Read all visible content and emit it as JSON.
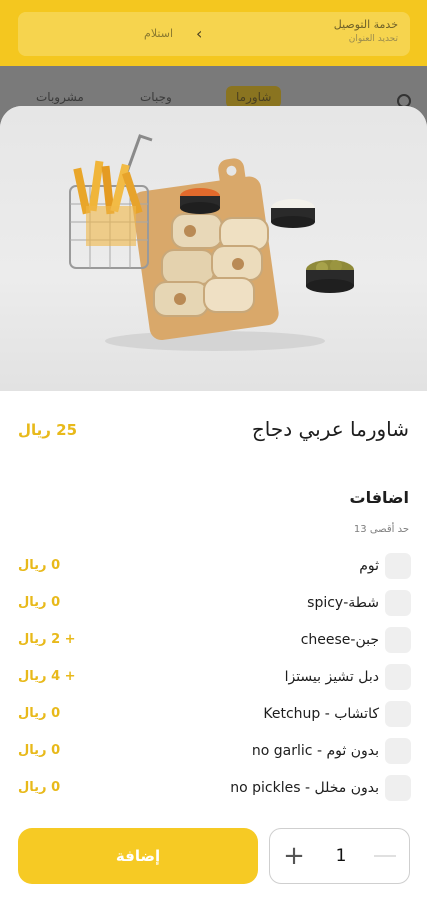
{
  "background": {
    "delivery_title": "خدمة التوصيل",
    "delivery_subtitle": "تحديد العنوان",
    "pickup_label": "استلام",
    "tabs": [
      "مشروبات",
      "وجبات",
      "شاورما"
    ]
  },
  "product": {
    "title": "شاورما عربي دجاج",
    "price": "25 ريال"
  },
  "addons": {
    "title": "اضافات",
    "limit_text": "حد أقصى 13",
    "items": [
      {
        "name": "ثوم",
        "price": "0 ريال",
        "checked": false
      },
      {
        "name": "شطة-spicy",
        "price": "0 ريال",
        "checked": false
      },
      {
        "name": "جبن-cheese",
        "price": "+ 2 ريال",
        "checked": false
      },
      {
        "name": "دبل تشيز بيستزا",
        "price": "+ 4 ريال",
        "checked": false
      },
      {
        "name": "كاتشاب - Ketchup",
        "price": "0 ريال",
        "checked": false
      },
      {
        "name": "بدون ثوم - no garlic",
        "price": "0 ريال",
        "checked": false
      },
      {
        "name": "بدون مخلل - no pickles",
        "price": "0 ريال",
        "checked": false
      }
    ]
  },
  "footer": {
    "quantity": "1",
    "add_label": "إضافة"
  },
  "colors": {
    "accent": "#f6ca24",
    "price": "#e8b91a",
    "checkbox": "#efefef"
  }
}
